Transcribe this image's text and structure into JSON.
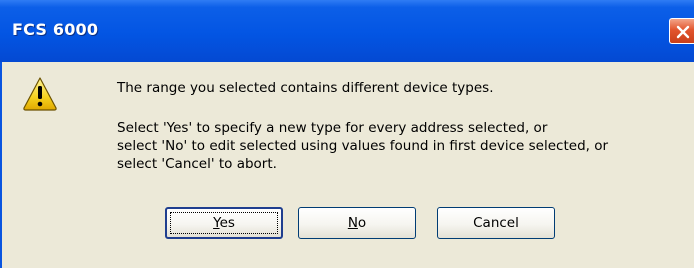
{
  "window": {
    "title": "FCS 6000"
  },
  "dialog": {
    "icon": "warning-icon",
    "message_line1": "The range you selected contains different device types.",
    "message_lines": [
      "Select 'Yes' to specify a new type for every address selected, or",
      "select 'No' to edit selected using values found in first device selected, or",
      "select 'Cancel' to abort."
    ]
  },
  "buttons": {
    "yes": {
      "first": "Y",
      "rest": "es"
    },
    "no": {
      "first": "N",
      "rest": "o"
    },
    "cancel": "Cancel"
  },
  "colors": {
    "titlebar": "#0355e3",
    "dialog_bg": "#ece9d8",
    "close_button": "#e2552e"
  }
}
